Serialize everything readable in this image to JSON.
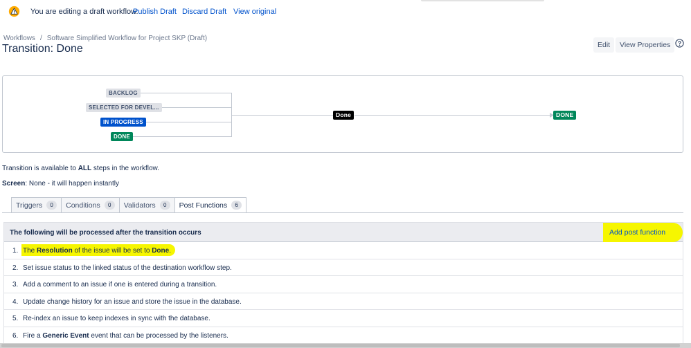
{
  "banner": {
    "message": "You are editing a draft workflow.",
    "publish": "Publish Draft",
    "discard": "Discard Draft",
    "view_original": "View original"
  },
  "breadcrumb": {
    "workflows": "Workflows",
    "separator": "/",
    "current": "Software Simplified Workflow for Project SKP (Draft)"
  },
  "page_title": "Transition: Done",
  "header_buttons": {
    "edit": "Edit",
    "view_properties": "View Properties"
  },
  "diagram": {
    "sources": [
      {
        "label": "BACKLOG",
        "color": "#dfe1e6"
      },
      {
        "label": "SELECTED FOR DEVEL...",
        "color": "#dfe1e6"
      },
      {
        "label": "IN PROGRESS",
        "color": "#0052cc"
      },
      {
        "label": "DONE",
        "color": "#00875a"
      }
    ],
    "transition": "Done",
    "target": "DONE"
  },
  "info": {
    "available_prefix": "Transition is available to ",
    "available_bold": "ALL",
    "available_suffix": " steps in the workflow.",
    "screen_label": "Screen",
    "screen_value": ": None - it will happen instantly"
  },
  "tabs": [
    {
      "label": "Triggers",
      "count": "0"
    },
    {
      "label": "Conditions",
      "count": "0"
    },
    {
      "label": "Validators",
      "count": "0"
    },
    {
      "label": "Post Functions",
      "count": "6"
    }
  ],
  "post_functions": {
    "header": "The following will be processed after the transition occurs",
    "add_label": "Add post function",
    "rows": [
      {
        "num": "1.",
        "pre": "The ",
        "b1": "Resolution",
        "mid": " of the issue will be set to ",
        "b2": "Done",
        "post": "."
      },
      {
        "num": "2.",
        "text": "Set issue status to the linked status of the destination workflow step."
      },
      {
        "num": "3.",
        "text": "Add a comment to an issue if one is entered during a transition."
      },
      {
        "num": "4.",
        "text": "Update change history for an issue and store the issue in the database."
      },
      {
        "num": "5.",
        "text": "Re-index an issue to keep indexes in sync with the database."
      },
      {
        "num": "6.",
        "pre": "Fire a ",
        "b1": "Generic Event",
        "post": " event that can be processed by the listeners."
      }
    ]
  },
  "colors": {
    "link": "#0052cc",
    "highlight": "#f6f600",
    "warning": "#ffab00"
  }
}
